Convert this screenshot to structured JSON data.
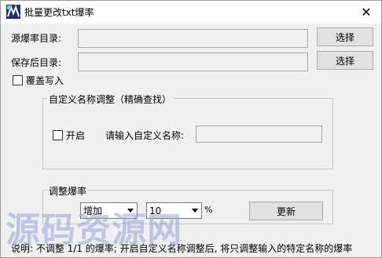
{
  "window": {
    "title": "批量更改txt爆率",
    "close_glyph": "✕"
  },
  "source": {
    "label": "源爆率目录:",
    "value": "",
    "browse_label": "选择"
  },
  "save": {
    "label": "保存后目录:",
    "value": "",
    "browse_label": "选择"
  },
  "overwrite": {
    "label": "覆盖写入",
    "checked": false
  },
  "custom_name_group": {
    "legend": "自定义名称调整（精确查找）",
    "enable_label": "开启",
    "enabled": false,
    "name_prompt": "请输入自定义名称:",
    "name_value": ""
  },
  "adjust_group": {
    "legend": "调整爆率",
    "mode_selected": "增加",
    "value_selected": "10",
    "percent_sign": "%",
    "update_label": "更新"
  },
  "footer": {
    "note": "说明: 不调整 1/1 的爆率; 开启自定义名称调整后, 将只调整输入的特定名称的爆率"
  },
  "watermark": {
    "text": "源码资源网"
  },
  "colors": {
    "window_bg": "#f0f0f0",
    "titlebar_bg": "#ffffff",
    "border": "#adadad",
    "watermark": "#96a0dc"
  }
}
